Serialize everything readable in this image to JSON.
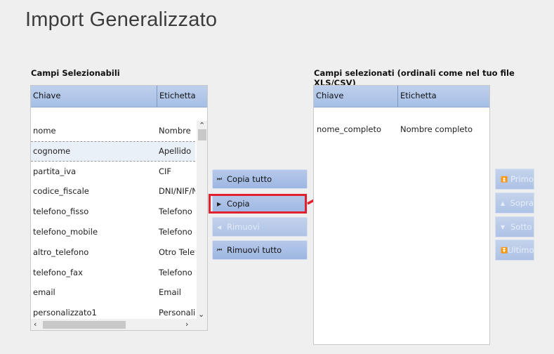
{
  "page": {
    "title": "Import Generalizzato"
  },
  "left": {
    "label": "Campi Selezionabili",
    "columns": [
      "Chiave",
      "Etichetta"
    ],
    "rows": [
      {
        "key": "nome",
        "label": "Nombre"
      },
      {
        "key": "cognome",
        "label": "Apellido"
      },
      {
        "key": "partita_iva",
        "label": "CIF"
      },
      {
        "key": "codice_fiscale",
        "label": "DNI/NIF/NI"
      },
      {
        "key": "telefono_fisso",
        "label": "Telefono F"
      },
      {
        "key": "telefono_mobile",
        "label": "Telefono M"
      },
      {
        "key": "altro_telefono",
        "label": "Otro Telef"
      },
      {
        "key": "telefono_fax",
        "label": "Telefono f"
      },
      {
        "key": "email",
        "label": "Email"
      },
      {
        "key": "personalizzato1",
        "label": "Personaliz"
      }
    ],
    "selected_row": "cognome"
  },
  "right": {
    "label": "Campi selezionati (ordinali come nel tuo file XLS/CSV)",
    "columns": [
      "Chiave",
      "Etichetta"
    ],
    "rows": [
      {
        "key": "nome_completo",
        "label": "Nombre completo"
      }
    ]
  },
  "buttons": {
    "copy_all": "Copia tutto",
    "copy": "Copia",
    "remove": "Rimuovi",
    "remove_all": "Rimuovi tutto"
  },
  "order_buttons": {
    "first": "Primo",
    "up": "Sopra",
    "down": "Sotto",
    "last": "Ultimo"
  },
  "colors": {
    "header_blue": "#a6bfe6",
    "highlight_red": "#e0222e"
  }
}
